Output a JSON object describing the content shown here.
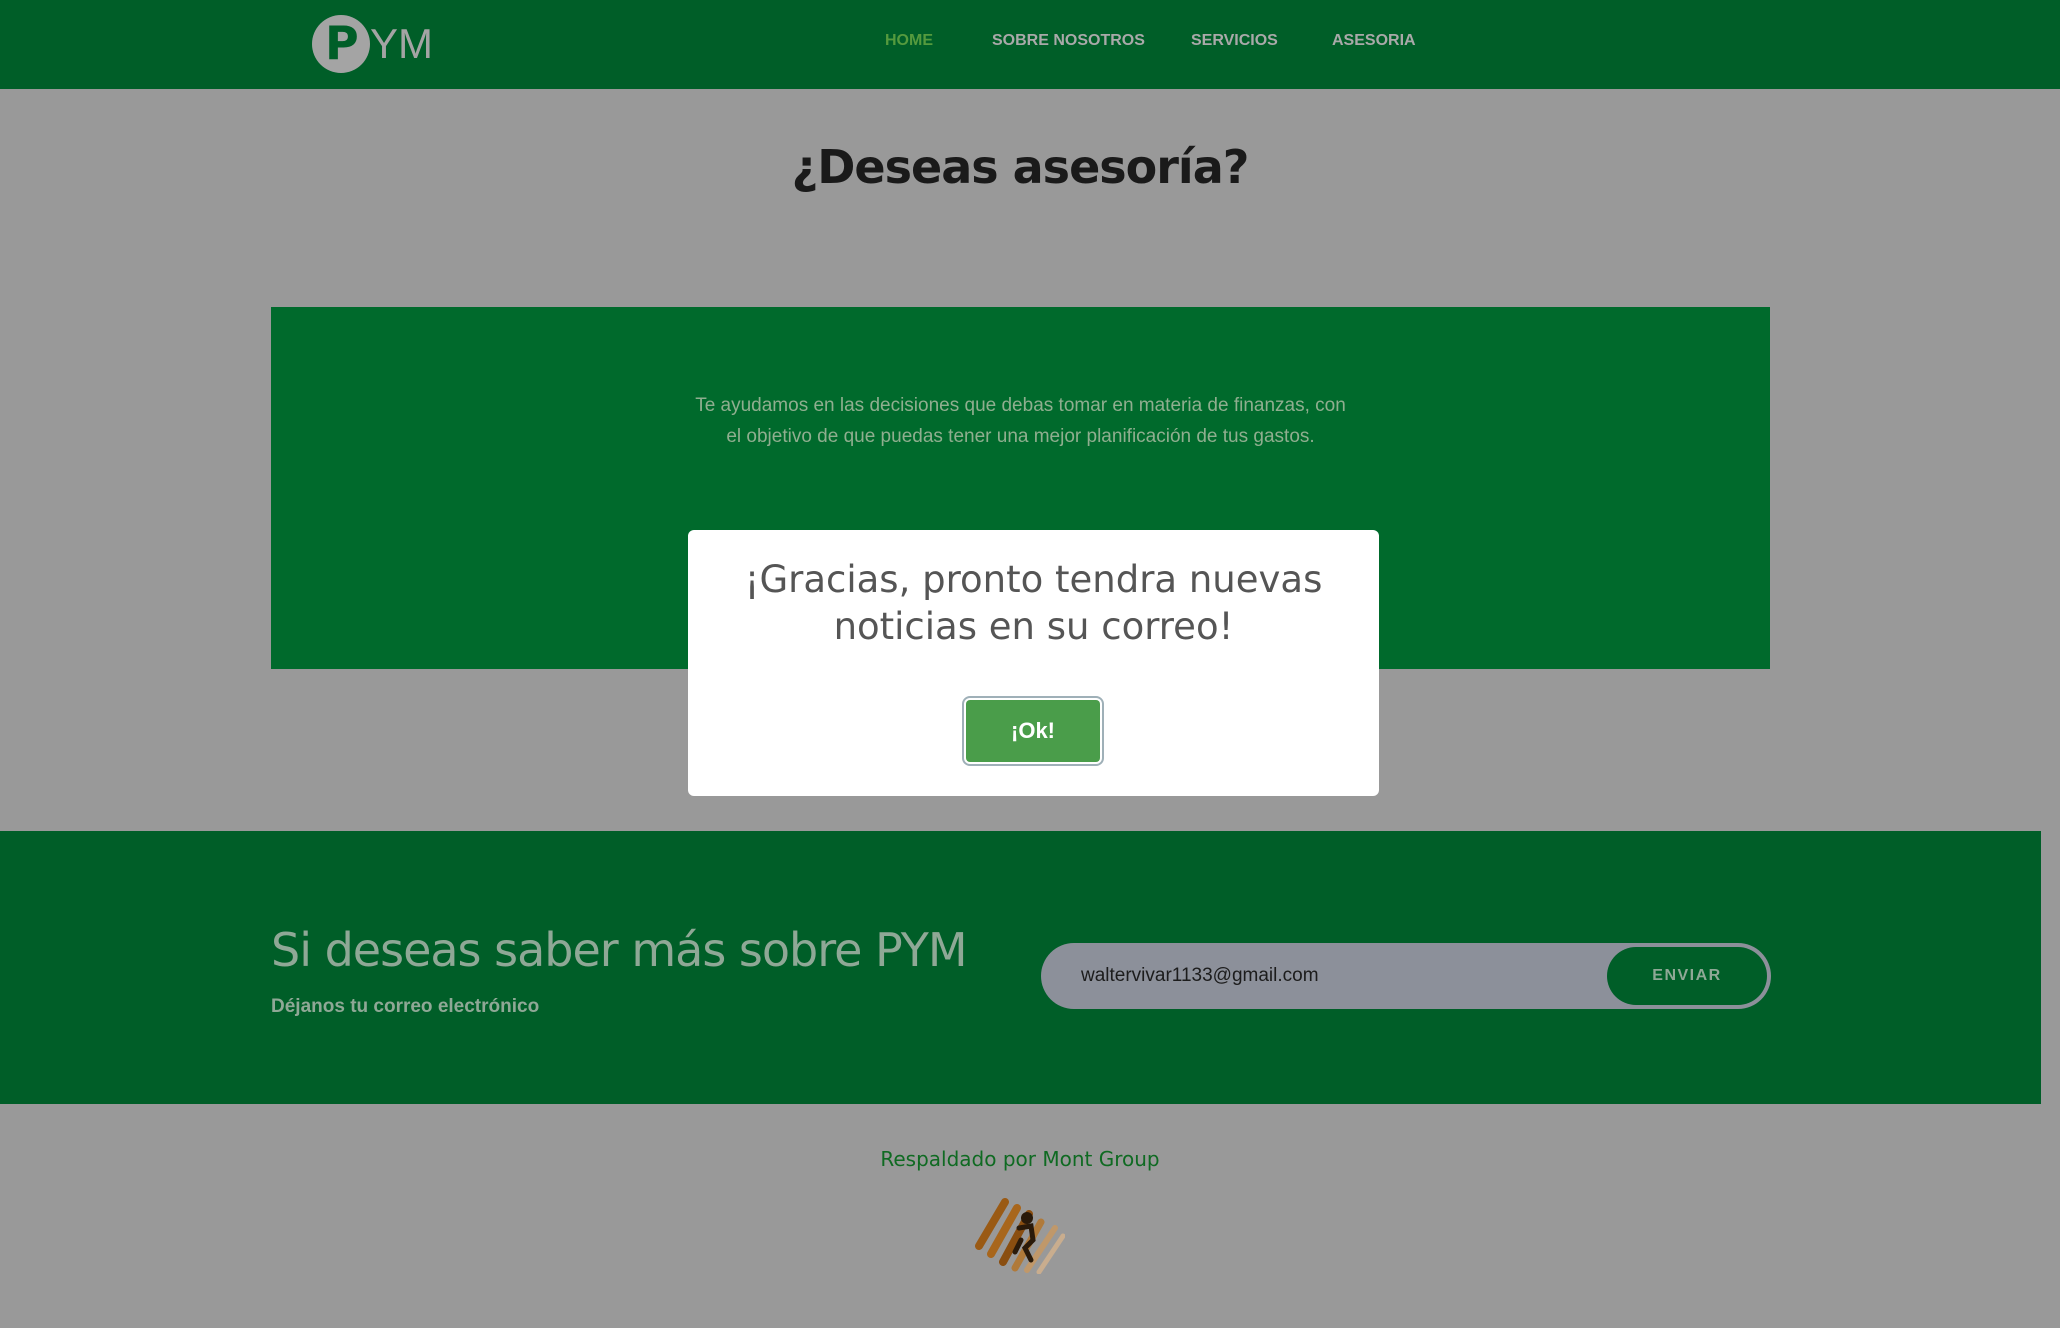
{
  "header": {
    "logo_text": "YM",
    "logo_initial": "P",
    "nav": [
      {
        "label": "HOME",
        "active": true
      },
      {
        "label": "SOBRE NOSOTROS",
        "active": false
      },
      {
        "label": "SERVICIOS",
        "active": false
      },
      {
        "label": "ASESORIA",
        "active": false
      }
    ]
  },
  "main": {
    "title": "¿Deseas asesoría?",
    "card_text_line1": "Te ayudamos en las decisiones que debas tomar en materia de finanzas, con",
    "card_text_line2": "el objetivo de que puedas tener una mejor planificación de tus gastos."
  },
  "newsletter": {
    "title": "Si deseas saber más sobre PYM",
    "subtitle": "Déjanos tu correo electrónico",
    "email_value": "waltervivar1133@gmail.com",
    "button_label": "ENVIAR"
  },
  "footer": {
    "text": "Respaldado por Mont Group",
    "logo_icon": "mont-group-logo"
  },
  "modal": {
    "title_line1": "¡Gracias, pronto tendra nuevas",
    "title_line2": "noticias en su correo!",
    "button_label": "¡Ok!"
  },
  "colors": {
    "header_bg": "#005e28",
    "card_bg": "#006a2c",
    "overlay_bg": "#999999",
    "nav_active": "#559a3e",
    "ok_button": "#4a9d4a"
  }
}
